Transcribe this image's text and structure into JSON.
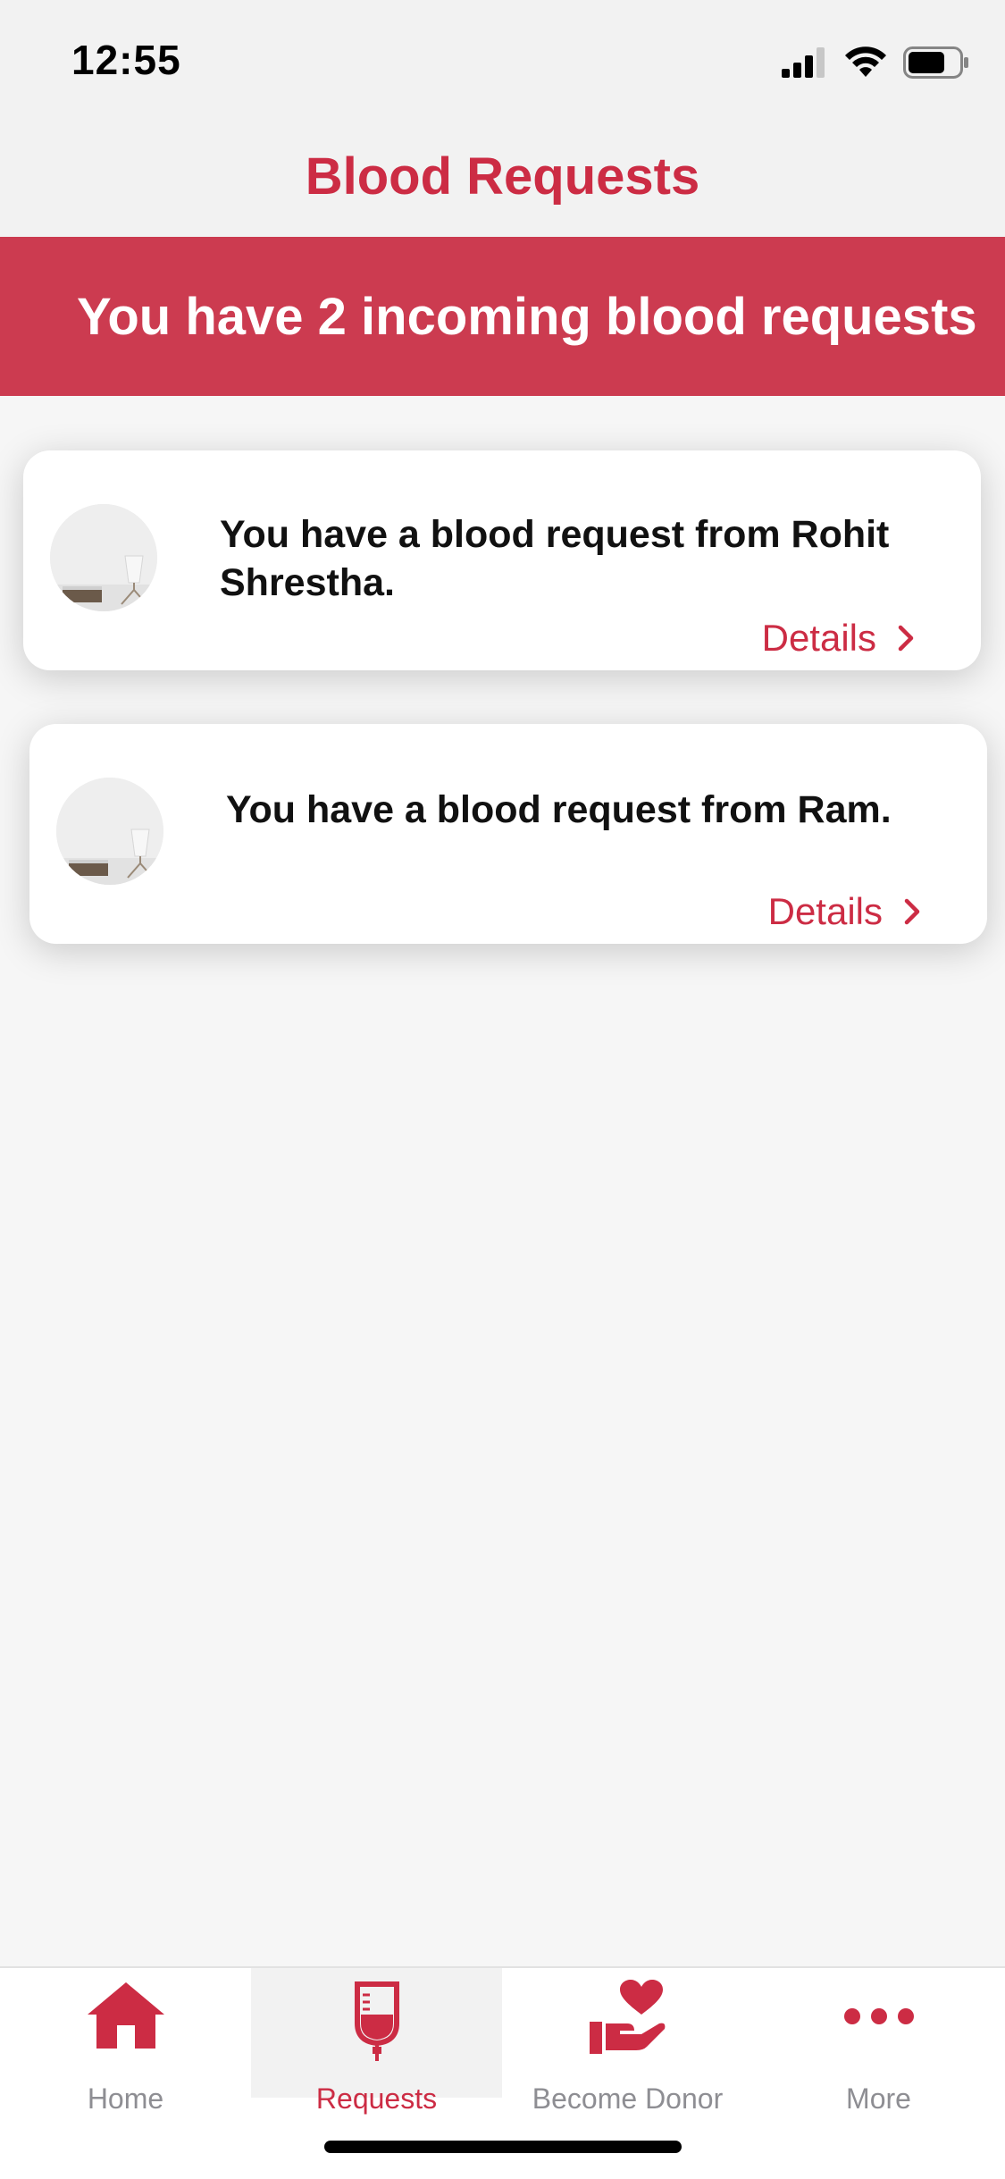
{
  "status_bar": {
    "time": "12:55"
  },
  "nav": {
    "title": "Blood Requests"
  },
  "banner": {
    "text": "You have 2 incoming blood requests"
  },
  "requests": [
    {
      "message": "You have a blood request from Rohit Shrestha.",
      "details_label": "Details"
    },
    {
      "message": "You have a blood request from Ram.",
      "details_label": "Details"
    }
  ],
  "tabs": [
    {
      "label": "Home",
      "icon": "home-icon",
      "active": false
    },
    {
      "label": "Requests",
      "icon": "blood-bag-icon",
      "active": true
    },
    {
      "label": "Become Donor",
      "icon": "donate-heart-hand-icon",
      "active": false
    },
    {
      "label": "More",
      "icon": "more-dots-icon",
      "active": false
    }
  ],
  "colors": {
    "accent": "#cc2c44",
    "banner": "#cc3b50",
    "inactive_tab": "#8e8e93",
    "background": "#f6f6f6"
  }
}
